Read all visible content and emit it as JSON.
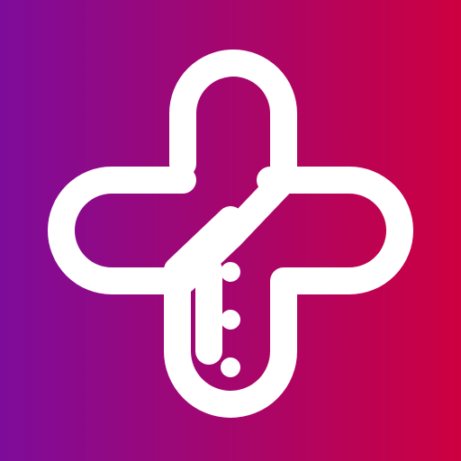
{
  "icon": {
    "name": "medical-cross-logo-icon"
  },
  "colors": {
    "gradient_left": "#7e0c9a",
    "gradient_right": "#cd0040",
    "foreground": "#ffffff"
  }
}
